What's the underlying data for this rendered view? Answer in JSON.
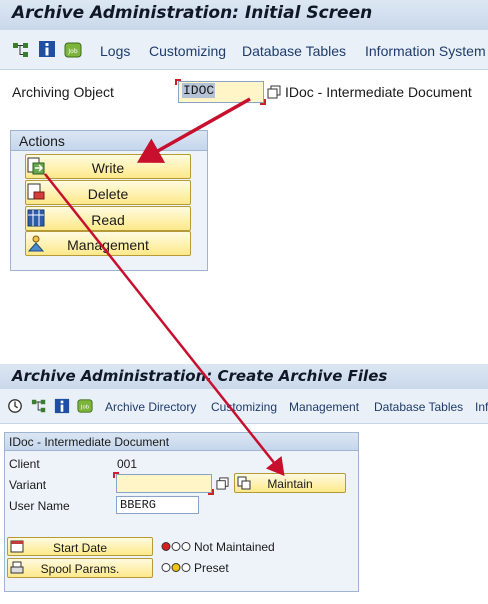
{
  "screen1": {
    "title": "Archive Administration: Initial Screen",
    "menu": [
      "Logs",
      "Customizing",
      "Database Tables",
      "Information System"
    ],
    "archiving_object_label": "Archiving Object",
    "archiving_object_value": "IDOC",
    "archiving_object_desc": "IDoc - Intermediate Document",
    "actions_title": "Actions",
    "actions": [
      "Write",
      "Delete",
      "Read",
      "Management"
    ]
  },
  "screen2": {
    "title": "Archive Administration: Create Archive Files",
    "menu": [
      "Archive Directory",
      "Customizing",
      "Management",
      "Database Tables",
      "Inf"
    ],
    "panel_title": "IDoc - Intermediate Document",
    "client_label": "Client",
    "client_value": "001",
    "variant_label": "Variant",
    "variant_value": "",
    "maintain_label": "Maintain",
    "user_label": "User Name",
    "user_value": "BBERG",
    "start_date_label": "Start Date",
    "spool_label": "Spool Params.",
    "status_not_maintained": "Not Maintained",
    "status_preset": "Preset"
  },
  "colors": {
    "arrow": "#c8102e",
    "button_fill": "#fde98a",
    "field_fill": "#fff5c7"
  }
}
